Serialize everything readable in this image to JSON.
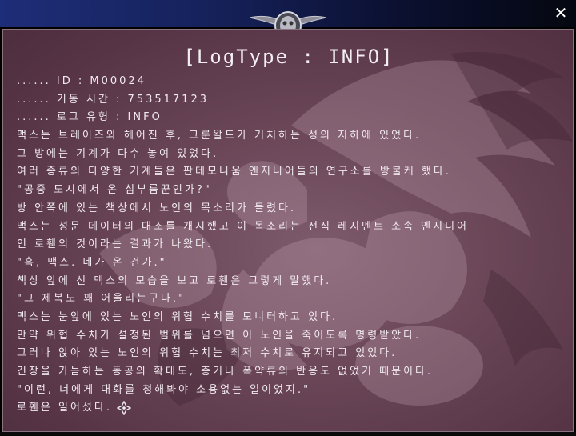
{
  "window": {
    "close_glyph": "✕"
  },
  "log": {
    "title": "[LogType : INFO]",
    "lines": [
      "...... ID : M00024",
      "...... 기동 시간 : 753517123",
      "...... 로그 유형 : INFO",
      "맥스는 브레이즈와 헤어진 후, 그룬왈드가 거처하는 성의 지하에 있었다.",
      "그 방에는 기계가 다수 놓여 있었다.",
      "여러 종류의 다양한 기계들은 판데모니움 엔지니어들의 연구소를 방불케 했다.",
      "\"공중 도시에서 온 심부름꾼인가?\"",
      "방 안쪽에 있는 책상에서 노인의 목소리가 들렸다.",
      "맥스는 성문 데이터의 대조를 개시했고 이 목소리는 전직 레지멘트 소속 엔지니어",
      "인 로휀의 것이라는 결과가 나왔다.",
      "\"흠, 맥스. 네가 온 건가.\"",
      "책상 앞에 선 맥스의 모습을 보고 로휀은 그렇게 말했다.",
      "\"그 제복도 꽤 어울리는구나.\"",
      "맥스는 눈앞에 있는 노인의 위협 수치를 모니터하고 있다.",
      "만약 위협 수치가 설정된 범위를 넘으면 이 노인을 죽이도록 명령받았다.",
      "그러나 앉아 있는 노인의 위협 수치는 최저 수치로 유지되고 있었다.",
      "긴장을 가늠하는 동공의 확대도, 총기나 폭약류의 반응도 없었기 때문이다.",
      "\"이런, 너에게 대화를 청해봐야 소용없는 일이었지.\"",
      "로휀은 일어섰다."
    ]
  },
  "icons": {
    "close": "close-icon",
    "emblem": "skull-emblem-icon",
    "continue": "continue-cursor-icon"
  },
  "colors": {
    "titlebar_left": "#1e2d78",
    "panel": "#6a4657",
    "text": "#f1eaee"
  }
}
